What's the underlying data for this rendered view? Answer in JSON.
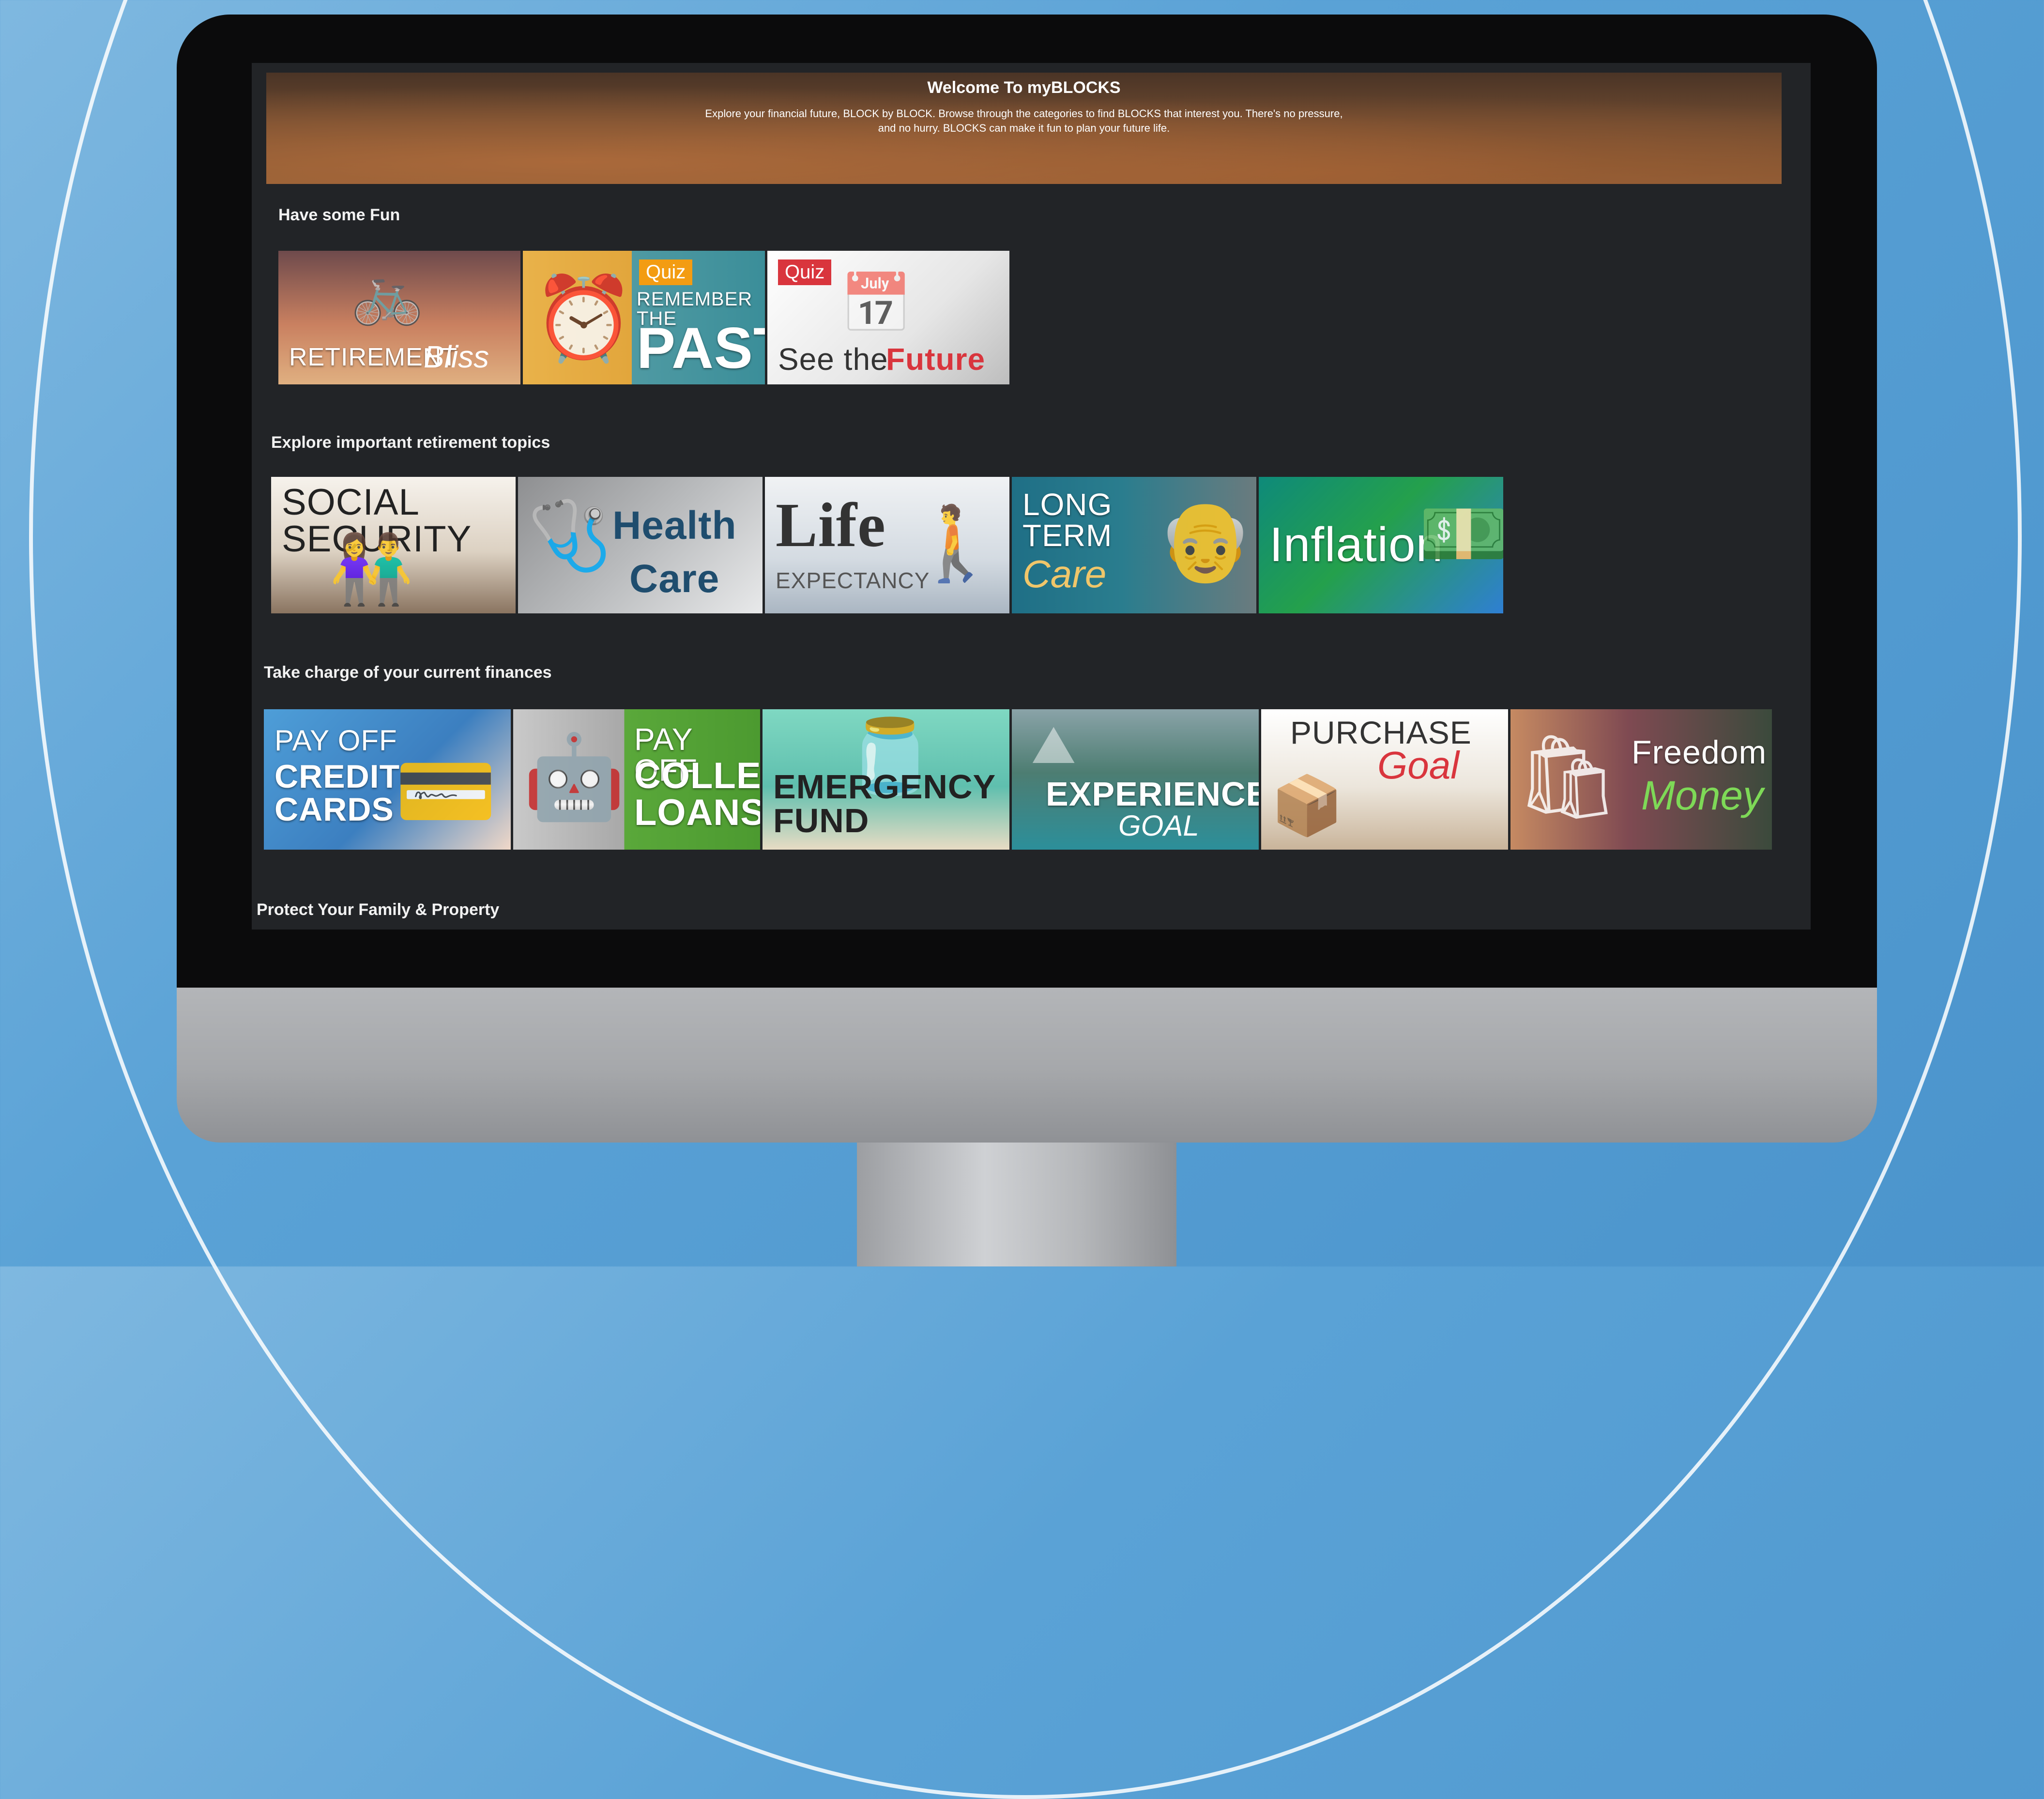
{
  "hero": {
    "title": "Welcome To myBLOCKS",
    "subtitle": "Explore your financial future, BLOCK by BLOCK. Browse through the categories to find BLOCKS that interest you. There's no pressure, and no hurry. BLOCKS can make it fun to plan your future life."
  },
  "sections": [
    {
      "title": "Have some Fun",
      "tiles": [
        {
          "main": "RETIREMENT",
          "accent": "Bliss"
        },
        {
          "badge": "Quiz",
          "main": "REMEMBER THE",
          "accent": "PAST"
        },
        {
          "badge": "Quiz",
          "main": "See the",
          "accent": "Future"
        }
      ]
    },
    {
      "title": "Explore important retirement topics",
      "tiles": [
        {
          "main": "SOCIAL SECURITY"
        },
        {
          "main": "Health",
          "accent": "Care"
        },
        {
          "main": "Life",
          "accent": "EXPECTANCY"
        },
        {
          "main": "LONG TERM",
          "accent": "Care"
        },
        {
          "main": "Inflation"
        }
      ]
    },
    {
      "title": "Take charge of your current finances",
      "tiles": [
        {
          "main": "PAY OFF",
          "accent": "CREDIT CARDS"
        },
        {
          "main": "PAY OFF",
          "accent": "COLLEGE LOANS"
        },
        {
          "main": "EMERGENCY FUND"
        },
        {
          "main": "EXPERIENCE",
          "accent": "GOAL"
        },
        {
          "main": "PURCHASE",
          "accent": "Goal"
        },
        {
          "main": "Freedom",
          "accent": "Money"
        }
      ]
    },
    {
      "title": "Protect Your Family & Property",
      "tiles": []
    }
  ],
  "colors": {
    "quiz_orange": "#f39c12",
    "quiz_red": "#d9353d",
    "future_red": "#d9353d",
    "money_green": "#7ed957"
  }
}
